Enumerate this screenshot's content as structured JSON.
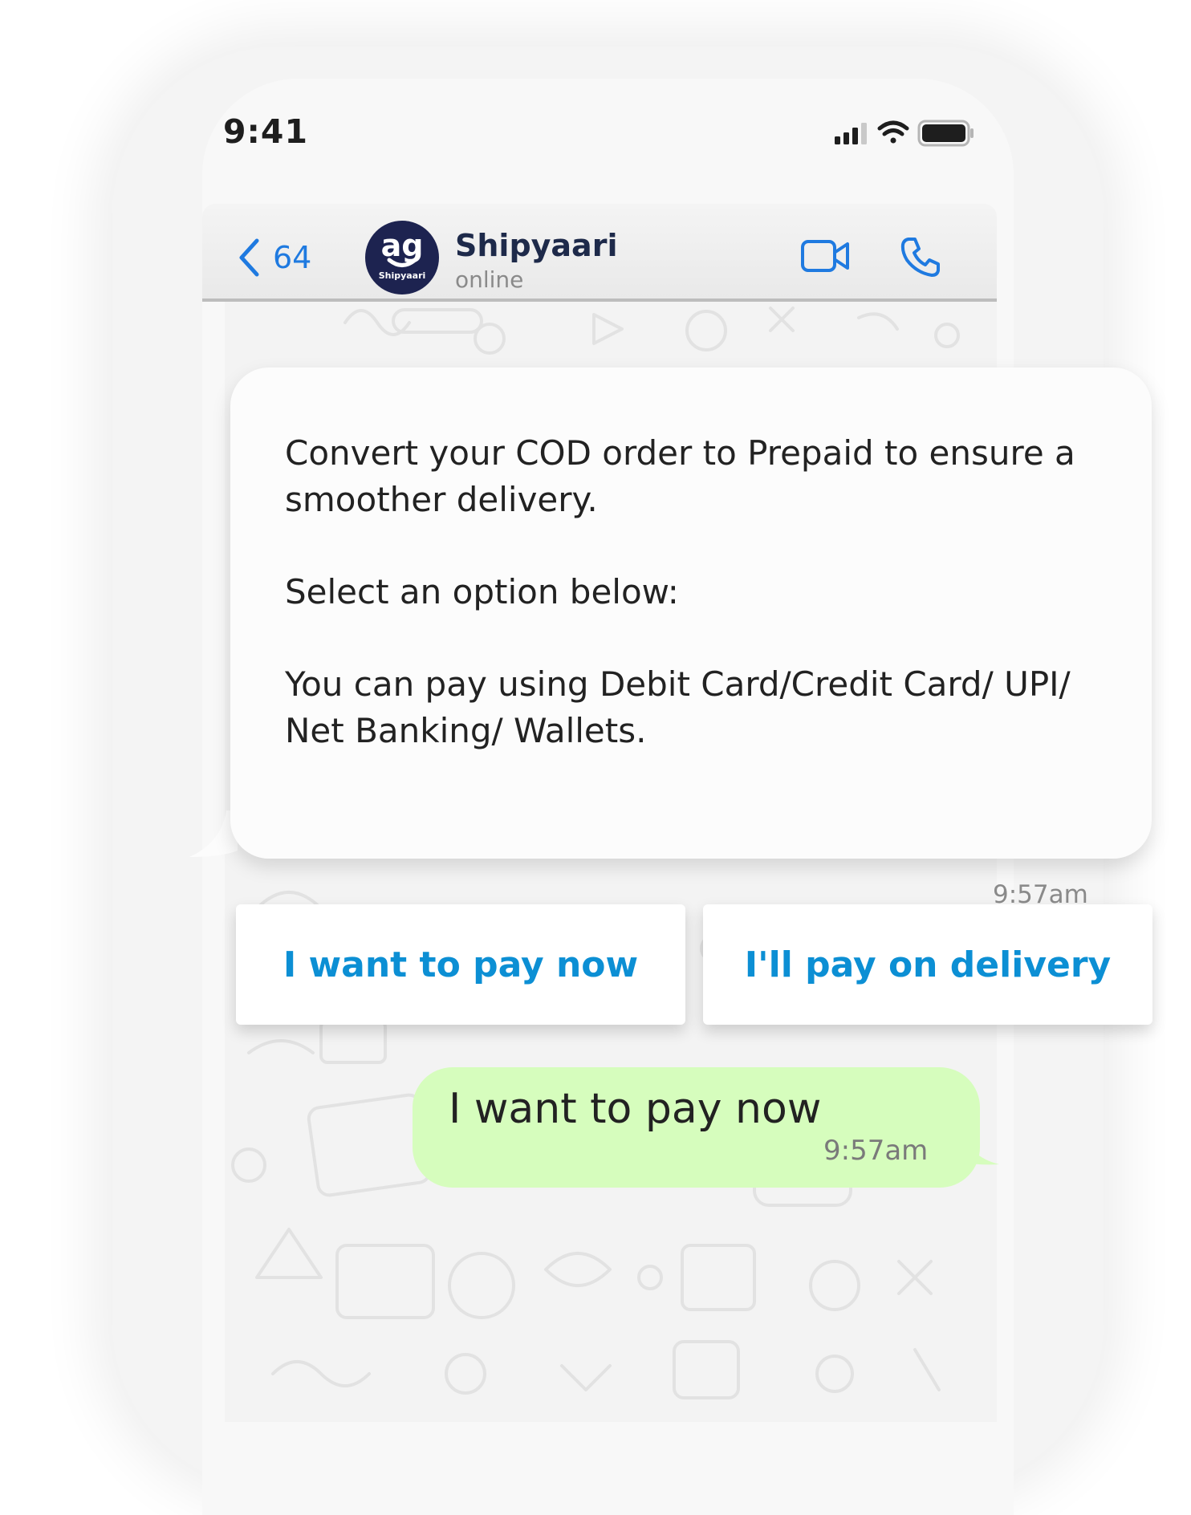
{
  "status_bar": {
    "time": "9:41",
    "icons": [
      "signal-icon",
      "wifi-icon",
      "battery-icon"
    ]
  },
  "header": {
    "back_count": "64",
    "back_icon": "chevron-left-icon",
    "avatar_glyph": "ag",
    "avatar_small": "Shipyaari",
    "contact_name": "Shipyaari",
    "contact_status": "online",
    "video_icon": "video-camera-icon",
    "call_icon": "phone-icon",
    "accent": "#1f7ae0"
  },
  "incoming_message": {
    "paragraphs": [
      "Convert your COD order to Prepaid to ensure a smoother delivery.",
      "Select an option below:",
      "You can pay using Debit Card/Credit Card/ UPI/ Net Banking/ Wallets."
    ],
    "time": "9:57am"
  },
  "quick_replies": [
    {
      "label": "I want to pay now"
    },
    {
      "label": "I'll pay on delivery"
    }
  ],
  "outgoing_message": {
    "text": "I want to pay now",
    "time": "9:57am",
    "bubble_color": "#d6fdbd"
  },
  "colors": {
    "button_text": "#0c8fd4",
    "avatar_bg": "#1d2350"
  }
}
